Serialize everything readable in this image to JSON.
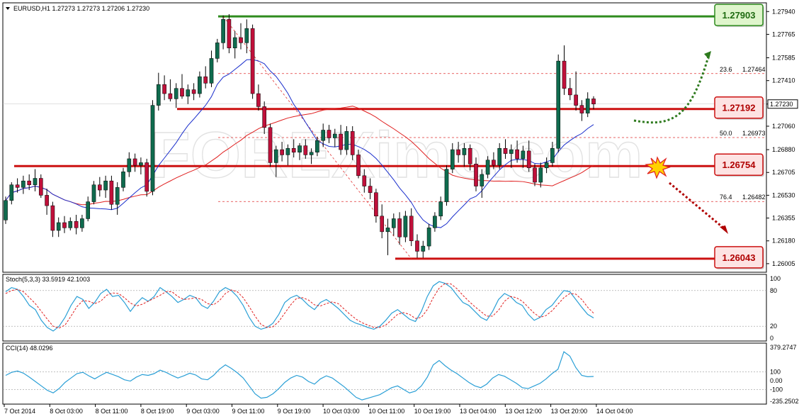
{
  "chart_data": {
    "type": "candlestick",
    "symbol_header": "EURUSD,H1  1.27273 1.27273 1.27206 1.27230",
    "price_axis": {
      "min": 1.2595,
      "max": 1.27985,
      "ticks": [
        "1.27940",
        "1.27765",
        "1.27585",
        "1.27410",
        "1.27230",
        "1.27060",
        "1.26880",
        "1.26705",
        "1.26530",
        "1.26355",
        "1.26180",
        "1.26005"
      ]
    },
    "current_price_label": "1.27230",
    "time_labels": [
      "7 Oct 2014",
      "8 Oct 03:00",
      "8 Oct 11:00",
      "8 Oct 19:00",
      "9 Oct 03:00",
      "9 Oct 11:00",
      "9 Oct 19:00",
      "10 Oct 03:00",
      "10 Oct 11:00",
      "10 Oct 19:00",
      "13 Oct 04:00",
      "13 Oct 12:00",
      "13 Oct 20:00",
      "14 Oct 04:00"
    ],
    "levels": [
      {
        "label": "1.27903",
        "value": 1.27903,
        "color": "#2e8b1e",
        "box_bg": "#dff5cc",
        "box_fg": "#1f6b12"
      },
      {
        "label": "1.27192",
        "value": 1.27192,
        "color": "#cc1111",
        "box_bg": "#fde3e3",
        "box_fg": "#b00000"
      },
      {
        "label": "1.26754",
        "value": 1.26754,
        "color": "#cc1111",
        "box_bg": "#fde3e3",
        "box_fg": "#b00000"
      },
      {
        "label": "1.26043",
        "value": 1.26043,
        "color": "#cc1111",
        "box_bg": "#fde3e3",
        "box_fg": "#b00000"
      }
    ],
    "fibonacci": [
      {
        "ratio": "23.6",
        "price": "1.27464",
        "value": 1.27464
      },
      {
        "ratio": "50.0",
        "price": "1.26973",
        "value": 1.26973
      },
      {
        "ratio": "76.4",
        "price": "1.26482",
        "value": 1.26482
      }
    ],
    "candles": [
      [
        1.2634,
        1.2652,
        1.2631,
        1.2649
      ],
      [
        1.2649,
        1.2663,
        1.2646,
        1.2661
      ],
      [
        1.2661,
        1.2666,
        1.2655,
        1.2659
      ],
      [
        1.2659,
        1.2668,
        1.2654,
        1.2664
      ],
      [
        1.2664,
        1.2669,
        1.2657,
        1.2661
      ],
      [
        1.2661,
        1.2673,
        1.2656,
        1.2666
      ],
      [
        1.2666,
        1.2669,
        1.2651,
        1.2653
      ],
      [
        1.2653,
        1.2658,
        1.2638,
        1.2645
      ],
      [
        1.2645,
        1.2648,
        1.2621,
        1.2626
      ],
      [
        1.2626,
        1.2636,
        1.2621,
        1.2632
      ],
      [
        1.2632,
        1.2637,
        1.2624,
        1.2628
      ],
      [
        1.2628,
        1.2636,
        1.2626,
        1.2633
      ],
      [
        1.2633,
        1.2638,
        1.2623,
        1.2628
      ],
      [
        1.2628,
        1.2638,
        1.2625,
        1.2635
      ],
      [
        1.2635,
        1.2652,
        1.2633,
        1.2648
      ],
      [
        1.2648,
        1.2664,
        1.2646,
        1.2661
      ],
      [
        1.2661,
        1.2667,
        1.2652,
        1.2657
      ],
      [
        1.2657,
        1.2668,
        1.2651,
        1.2664
      ],
      [
        1.2664,
        1.2668,
        1.2642,
        1.2646
      ],
      [
        1.2646,
        1.2663,
        1.2638,
        1.2659
      ],
      [
        1.2659,
        1.2674,
        1.2656,
        1.2671
      ],
      [
        1.2671,
        1.2686,
        1.2667,
        1.2681
      ],
      [
        1.2681,
        1.2685,
        1.2671,
        1.2676
      ],
      [
        1.2676,
        1.2682,
        1.2669,
        1.2678
      ],
      [
        1.2678,
        1.2681,
        1.2652,
        1.2656
      ],
      [
        1.2656,
        1.2726,
        1.2653,
        1.2722
      ],
      [
        1.2722,
        1.2747,
        1.2718,
        1.2738
      ],
      [
        1.2738,
        1.2745,
        1.2726,
        1.2731
      ],
      [
        1.2731,
        1.2742,
        1.2725,
        1.2727
      ],
      [
        1.2727,
        1.2739,
        1.272,
        1.2735
      ],
      [
        1.2735,
        1.2746,
        1.2727,
        1.2729
      ],
      [
        1.2729,
        1.2738,
        1.2723,
        1.2734
      ],
      [
        1.2734,
        1.2739,
        1.2726,
        1.2731
      ],
      [
        1.2731,
        1.2748,
        1.2728,
        1.2744
      ],
      [
        1.2744,
        1.2752,
        1.2735,
        1.2739
      ],
      [
        1.2739,
        1.2764,
        1.2736,
        1.2758
      ],
      [
        1.2758,
        1.2773,
        1.2755,
        1.277
      ],
      [
        1.277,
        1.2791,
        1.2765,
        1.2788
      ],
      [
        1.2788,
        1.2792,
        1.2762,
        1.2766
      ],
      [
        1.2766,
        1.2779,
        1.2758,
        1.2774
      ],
      [
        1.2774,
        1.2785,
        1.2765,
        1.277
      ],
      [
        1.277,
        1.2788,
        1.2762,
        1.2781
      ],
      [
        1.2781,
        1.2784,
        1.2727,
        1.2731
      ],
      [
        1.2731,
        1.2738,
        1.2718,
        1.2721
      ],
      [
        1.2721,
        1.2725,
        1.27,
        1.2705
      ],
      [
        1.2705,
        1.2708,
        1.2675,
        1.2678
      ],
      [
        1.2678,
        1.2691,
        1.2667,
        1.2688
      ],
      [
        1.2688,
        1.2694,
        1.2679,
        1.2684
      ],
      [
        1.2684,
        1.2692,
        1.2676,
        1.2689
      ],
      [
        1.2689,
        1.2696,
        1.2682,
        1.2686
      ],
      [
        1.2686,
        1.2693,
        1.268,
        1.2691
      ],
      [
        1.2691,
        1.2696,
        1.2681,
        1.2684
      ],
      [
        1.2684,
        1.2689,
        1.2677,
        1.2686
      ],
      [
        1.2686,
        1.2698,
        1.2683,
        1.2695
      ],
      [
        1.2695,
        1.2708,
        1.269,
        1.2703
      ],
      [
        1.2703,
        1.2707,
        1.2693,
        1.2697
      ],
      [
        1.2697,
        1.2704,
        1.269,
        1.27
      ],
      [
        1.27,
        1.2707,
        1.2684,
        1.2688
      ],
      [
        1.2688,
        1.2706,
        1.2684,
        1.2702
      ],
      [
        1.2702,
        1.2706,
        1.268,
        1.2684
      ],
      [
        1.2684,
        1.2688,
        1.2666,
        1.2668
      ],
      [
        1.2668,
        1.2673,
        1.2655,
        1.266
      ],
      [
        1.266,
        1.2666,
        1.265,
        1.2655
      ],
      [
        1.2655,
        1.2658,
        1.2632,
        1.2637
      ],
      [
        1.2637,
        1.2646,
        1.262,
        1.2625
      ],
      [
        1.2625,
        1.2635,
        1.2607,
        1.2628
      ],
      [
        1.2628,
        1.2639,
        1.2622,
        1.2635
      ],
      [
        1.2635,
        1.264,
        1.2615,
        1.2621
      ],
      [
        1.2621,
        1.2641,
        1.2617,
        1.2637
      ],
      [
        1.2637,
        1.2643,
        1.2614,
        1.2618
      ],
      [
        1.2618,
        1.2623,
        1.2605,
        1.261
      ],
      [
        1.261,
        1.2618,
        1.2605,
        1.2614
      ],
      [
        1.2614,
        1.2631,
        1.2611,
        1.2628
      ],
      [
        1.2628,
        1.264,
        1.2625,
        1.2637
      ],
      [
        1.2637,
        1.2652,
        1.2634,
        1.2648
      ],
      [
        1.2648,
        1.2676,
        1.2645,
        1.2673
      ],
      [
        1.2673,
        1.2693,
        1.267,
        1.2688
      ],
      [
        1.2688,
        1.2694,
        1.2678,
        1.2684
      ],
      [
        1.2684,
        1.2693,
        1.2675,
        1.2689
      ],
      [
        1.2689,
        1.2692,
        1.2672,
        1.2677
      ],
      [
        1.2677,
        1.2682,
        1.2656,
        1.266
      ],
      [
        1.266,
        1.2673,
        1.2651,
        1.2669
      ],
      [
        1.2669,
        1.2683,
        1.2666,
        1.268
      ],
      [
        1.268,
        1.2686,
        1.2673,
        1.2676
      ],
      [
        1.2676,
        1.2693,
        1.2673,
        1.2689
      ],
      [
        1.2689,
        1.2696,
        1.2681,
        1.2685
      ],
      [
        1.2685,
        1.2692,
        1.2674,
        1.2688
      ],
      [
        1.2688,
        1.2695,
        1.2678,
        1.2681
      ],
      [
        1.2681,
        1.2691,
        1.2674,
        1.2687
      ],
      [
        1.2687,
        1.2695,
        1.2671,
        1.2674
      ],
      [
        1.2674,
        1.2677,
        1.266,
        1.2663
      ],
      [
        1.2663,
        1.2678,
        1.2659,
        1.2674
      ],
      [
        1.2674,
        1.2682,
        1.267,
        1.2678
      ],
      [
        1.2678,
        1.2694,
        1.2675,
        1.2689
      ],
      [
        1.2689,
        1.2761,
        1.2686,
        1.2756
      ],
      [
        1.2756,
        1.2768,
        1.273,
        1.2735
      ],
      [
        1.2735,
        1.2743,
        1.2726,
        1.273
      ],
      [
        1.273,
        1.2748,
        1.2718,
        1.2722
      ],
      [
        1.2722,
        1.2726,
        1.271,
        1.2716
      ],
      [
        1.2716,
        1.2732,
        1.2713,
        1.2727
      ],
      [
        1.2727,
        1.2729,
        1.2719,
        1.2723
      ]
    ],
    "indicator_ma_blue": "20-period moving average (blue)",
    "indicator_ma_red": "50-period moving average (red)",
    "stoch": {
      "header": "Stoch(5,3,3) 33.5919 42.1003",
      "levels": [
        "100",
        "80",
        "20",
        "0"
      ],
      "k": [
        78,
        85,
        82,
        70,
        55,
        48,
        30,
        18,
        12,
        20,
        35,
        55,
        70,
        65,
        50,
        60,
        75,
        82,
        70,
        72,
        60,
        45,
        58,
        68,
        62,
        70,
        85,
        78,
        70,
        60,
        65,
        72,
        68,
        55,
        50,
        62,
        78,
        85,
        80,
        70,
        55,
        35,
        20,
        15,
        18,
        25,
        40,
        60,
        68,
        72,
        65,
        55,
        48,
        60,
        65,
        58,
        50,
        40,
        30,
        25,
        22,
        18,
        15,
        20,
        30,
        42,
        48,
        40,
        32,
        28,
        45,
        70,
        88,
        95,
        92,
        85,
        72,
        60,
        55,
        45,
        35,
        30,
        45,
        65,
        75,
        70,
        60,
        55,
        40,
        30,
        35,
        48,
        55,
        68,
        80,
        78,
        65,
        52,
        40,
        34
      ],
      "d": [
        75,
        80,
        82,
        78,
        68,
        58,
        45,
        32,
        20,
        17,
        22,
        37,
        53,
        63,
        62,
        58,
        62,
        72,
        76,
        75,
        68,
        59,
        54,
        57,
        62,
        67,
        72,
        78,
        78,
        70,
        65,
        66,
        68,
        65,
        58,
        56,
        63,
        75,
        81,
        78,
        68,
        53,
        37,
        23,
        18,
        19,
        28,
        42,
        56,
        67,
        68,
        64,
        56,
        54,
        58,
        61,
        58,
        49,
        40,
        32,
        26,
        22,
        18,
        18,
        22,
        31,
        40,
        43,
        40,
        33,
        35,
        48,
        68,
        84,
        92,
        91,
        83,
        72,
        62,
        53,
        45,
        37,
        37,
        47,
        62,
        70,
        68,
        62,
        52,
        42,
        35,
        38,
        46,
        57,
        68,
        75,
        74,
        65,
        52,
        42
      ]
    },
    "cci": {
      "header": "CCI(14) 48.0296",
      "levels": [
        "379.2747",
        "100",
        "0.00",
        "-100",
        "-235.2502"
      ],
      "values": [
        60,
        95,
        110,
        85,
        40,
        -10,
        -60,
        -110,
        -140,
        -90,
        -20,
        30,
        80,
        95,
        55,
        20,
        60,
        95,
        70,
        45,
        10,
        -5,
        40,
        70,
        60,
        80,
        120,
        95,
        60,
        30,
        55,
        85,
        65,
        20,
        10,
        60,
        130,
        180,
        140,
        90,
        30,
        -60,
        -150,
        -200,
        -190,
        -150,
        -90,
        -20,
        30,
        60,
        40,
        -10,
        -40,
        20,
        55,
        30,
        -20,
        -70,
        -130,
        -190,
        -220,
        -200,
        -180,
        -160,
        -120,
        -80,
        -60,
        -100,
        -140,
        -120,
        -60,
        40,
        180,
        230,
        170,
        120,
        80,
        30,
        -20,
        -60,
        -80,
        -40,
        30,
        70,
        50,
        10,
        -30,
        -80,
        -90,
        -60,
        -30,
        20,
        80,
        130,
        330,
        280,
        150,
        60,
        45,
        48
      ]
    },
    "watermark": "FOREXimo.com"
  }
}
